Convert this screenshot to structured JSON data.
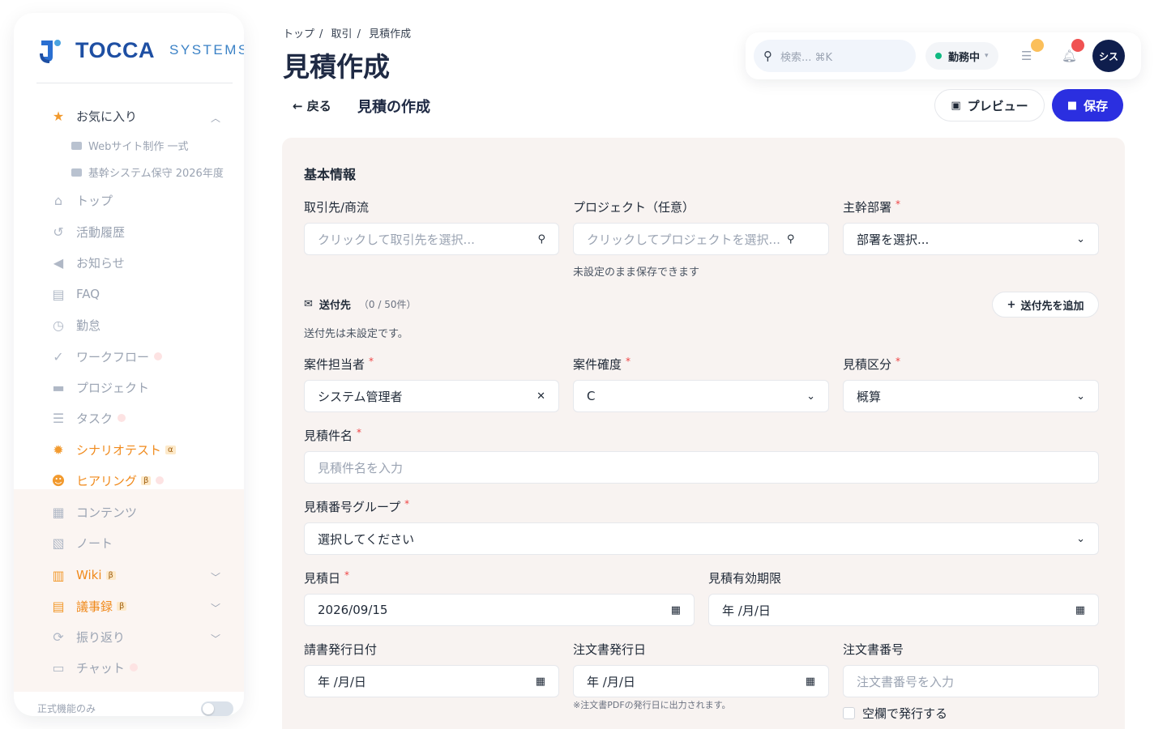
{
  "brand": {
    "name": "TOCCA",
    "suffix": "SYSTEMS"
  },
  "sidebar": {
    "favorites": {
      "label": "お気に入り",
      "items": [
        "Webサイト制作 一式",
        "基幹システム保守 2026年度"
      ]
    },
    "items": [
      {
        "label": "トップ"
      },
      {
        "label": "活動履歴"
      },
      {
        "label": "お知らせ"
      },
      {
        "label": "FAQ"
      },
      {
        "label": "勤怠"
      },
      {
        "label": "ワークフロー"
      },
      {
        "label": "プロジェクト"
      },
      {
        "label": "タスク"
      },
      {
        "label": "シナリオテスト",
        "badge": "α"
      },
      {
        "label": "ヒアリング",
        "badge": "β"
      },
      {
        "label": "コンテンツ"
      },
      {
        "label": "ノート"
      },
      {
        "label": "Wiki",
        "badge": "β"
      },
      {
        "label": "議事録",
        "badge": "β"
      },
      {
        "label": "振り返り"
      },
      {
        "label": "チャット"
      }
    ],
    "footer_label": "正式機能のみ"
  },
  "breadcrumb": [
    "トップ",
    "取引",
    "見積作成"
  ],
  "page_title": "見積作成",
  "topbar": {
    "search_placeholder": "検索... ⌘K",
    "status": "勤務中",
    "avatar": "シス"
  },
  "subheader": {
    "back": "戻る",
    "title": "見積の作成",
    "preview": "プレビュー",
    "save": "保存"
  },
  "form": {
    "section": "基本情報",
    "client": {
      "label": "取引先/商流",
      "placeholder": "クリックして取引先を選択..."
    },
    "project": {
      "label": "プロジェクト（任意）",
      "placeholder": "クリックしてプロジェクトを選択...",
      "hint": "未設定のまま保存できます"
    },
    "department": {
      "label": "主幹部署",
      "value": "部署を選択..."
    },
    "recipients": {
      "label": "送付先",
      "count": "（0 / 50件）",
      "empty": "送付先は未設定です。",
      "add": "送付先を追加"
    },
    "owner": {
      "label": "案件担当者",
      "value": "システム管理者"
    },
    "certainty": {
      "label": "案件確度",
      "value": "C"
    },
    "category": {
      "label": "見積区分",
      "value": "概算"
    },
    "name": {
      "label": "見積件名",
      "placeholder": "見積件名を入力"
    },
    "number_group": {
      "label": "見積番号グループ",
      "value": "選択してください"
    },
    "date": {
      "label": "見積日",
      "value": "2026/09/15"
    },
    "valid_until": {
      "label": "見積有効期限",
      "value": "年 /月/日"
    },
    "ack_date": {
      "label": "請書発行日付",
      "value": "年 /月/日"
    },
    "order_date": {
      "label": "注文書発行日",
      "value": "年 /月/日",
      "hint": "※注文書PDFの発行日に出力されます。"
    },
    "order_number": {
      "label": "注文書番号",
      "placeholder": "注文書番号を入力"
    },
    "blank_issue": {
      "label": "空欄で発行する"
    }
  },
  "colors": {
    "primary": "#2b2fe0",
    "accent": "#f08a1c",
    "required": "#ef4444"
  }
}
